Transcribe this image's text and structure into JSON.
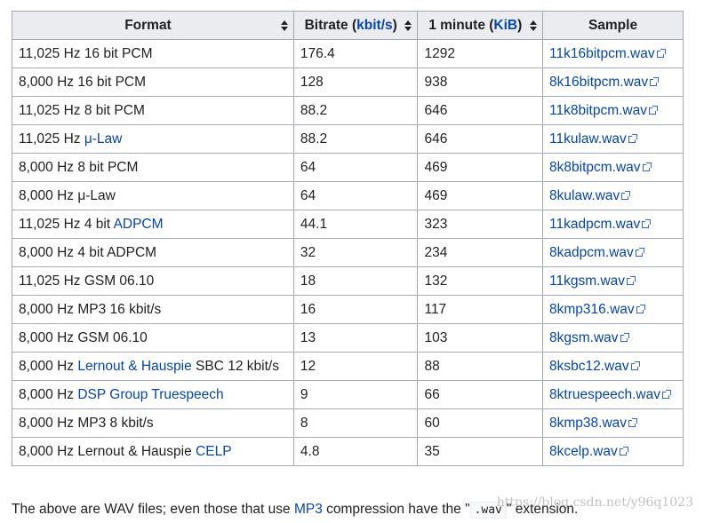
{
  "table": {
    "headers": {
      "format": "Format",
      "bitrate_prefix": "Bitrate (",
      "bitrate_unit": "kbit/s",
      "bitrate_suffix": ")",
      "minute_prefix": "1 minute (",
      "minute_unit": "KiB",
      "minute_suffix": ")",
      "sample": "Sample"
    },
    "rows": [
      {
        "fmt_pre": "11,025 Hz 16 bit PCM",
        "fmt_link": "",
        "fmt_post": "",
        "bitrate": "176.4",
        "minute": "1292",
        "sample": "11k16bitpcm.wav"
      },
      {
        "fmt_pre": "8,000 Hz 16 bit PCM",
        "fmt_link": "",
        "fmt_post": "",
        "bitrate": "128",
        "minute": "938",
        "sample": "8k16bitpcm.wav"
      },
      {
        "fmt_pre": "11,025 Hz 8 bit PCM",
        "fmt_link": "",
        "fmt_post": "",
        "bitrate": "88.2",
        "minute": "646",
        "sample": "11k8bitpcm.wav"
      },
      {
        "fmt_pre": "11,025 Hz ",
        "fmt_link": "μ-Law",
        "fmt_post": "",
        "bitrate": "88.2",
        "minute": "646",
        "sample": "11kulaw.wav"
      },
      {
        "fmt_pre": "8,000 Hz 8 bit PCM",
        "fmt_link": "",
        "fmt_post": "",
        "bitrate": "64",
        "minute": "469",
        "sample": "8k8bitpcm.wav"
      },
      {
        "fmt_pre": "8,000 Hz μ-Law",
        "fmt_link": "",
        "fmt_post": "",
        "bitrate": "64",
        "minute": "469",
        "sample": "8kulaw.wav"
      },
      {
        "fmt_pre": "11,025 Hz 4 bit ",
        "fmt_link": "ADPCM",
        "fmt_post": "",
        "bitrate": "44.1",
        "minute": "323",
        "sample": "11kadpcm.wav"
      },
      {
        "fmt_pre": "8,000 Hz 4 bit ADPCM",
        "fmt_link": "",
        "fmt_post": "",
        "bitrate": "32",
        "minute": "234",
        "sample": "8kadpcm.wav"
      },
      {
        "fmt_pre": "11,025 Hz GSM 06.10",
        "fmt_link": "",
        "fmt_post": "",
        "bitrate": "18",
        "minute": "132",
        "sample": "11kgsm.wav"
      },
      {
        "fmt_pre": "8,000 Hz MP3 16 kbit/s",
        "fmt_link": "",
        "fmt_post": "",
        "bitrate": "16",
        "minute": "117",
        "sample": "8kmp316.wav"
      },
      {
        "fmt_pre": "8,000 Hz GSM 06.10",
        "fmt_link": "",
        "fmt_post": "",
        "bitrate": "13",
        "minute": "103",
        "sample": "8kgsm.wav"
      },
      {
        "fmt_pre": "8,000 Hz ",
        "fmt_link": "Lernout & Hauspie",
        "fmt_post": " SBC 12 kbit/s",
        "bitrate": "12",
        "minute": "88",
        "sample": "8ksbc12.wav"
      },
      {
        "fmt_pre": "8,000 Hz ",
        "fmt_link": "DSP Group Truespeech",
        "fmt_post": "",
        "bitrate": "9",
        "minute": "66",
        "sample": "8ktruespeech.wav"
      },
      {
        "fmt_pre": "8,000 Hz MP3 8 kbit/s",
        "fmt_link": "",
        "fmt_post": "",
        "bitrate": "8",
        "minute": "60",
        "sample": "8kmp38.wav"
      },
      {
        "fmt_pre": "8,000 Hz Lernout & Hauspie ",
        "fmt_link": "CELP",
        "fmt_post": "",
        "bitrate": "4.8",
        "minute": "35",
        "sample": "8kcelp.wav"
      }
    ]
  },
  "footnote": {
    "pre": "The above are WAV files; even those that use ",
    "link": "MP3",
    "mid": " compression have the \"",
    "code": ".wav",
    "post": "\" extension."
  },
  "watermark": "https://blog.csdn.net/y96q1023",
  "colors": {
    "link": "#0645ad",
    "header_bg": "#eaecf0",
    "border": "#a2a9b1",
    "text": "#202122"
  }
}
